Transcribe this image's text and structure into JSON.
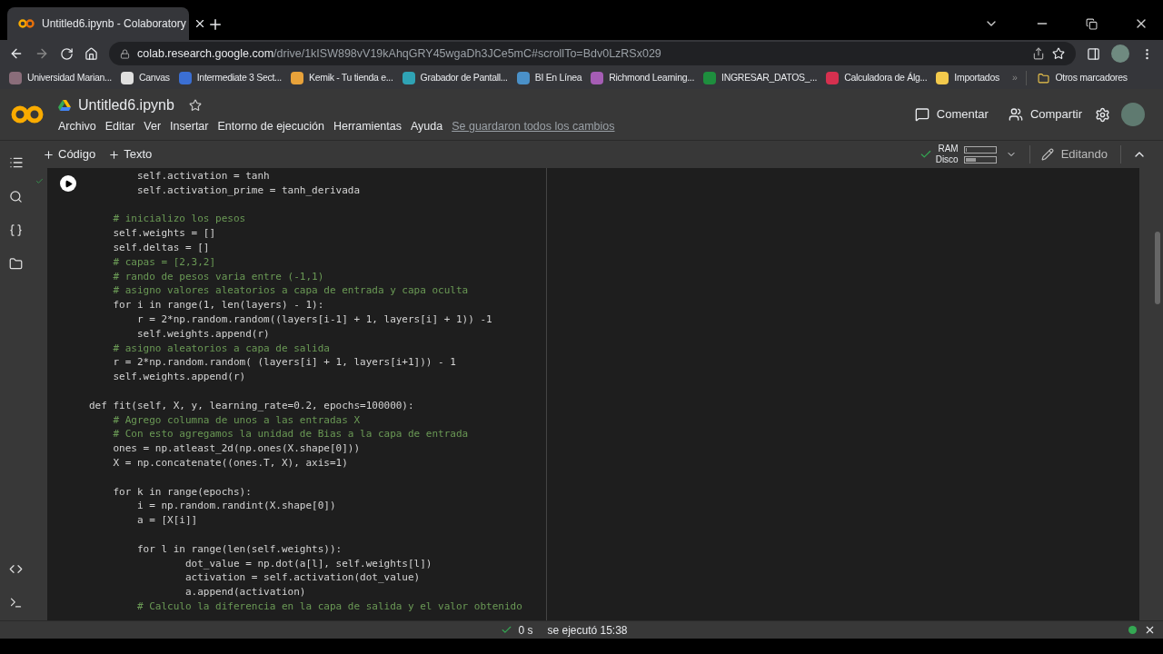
{
  "browser": {
    "tab_title": "Untitled6.ipynb - Colaboratory",
    "url_host": "colab.research.google.com",
    "url_path": "/drive/1kISW898vV19kAhqGRY45wgaDh3JCe5mC#scrollTo=Bdv0LzRSx029",
    "bookmarks": [
      {
        "label": "Universidad Marian...",
        "color": "#8a6d7a"
      },
      {
        "label": "Canvas",
        "color": "#e0e0e0"
      },
      {
        "label": "Intermediate 3 Sect...",
        "color": "#3b6fd4"
      },
      {
        "label": "Kemik - Tu tienda e...",
        "color": "#e8a23a"
      },
      {
        "label": "Grabador de Pantall...",
        "color": "#2fa3b5"
      },
      {
        "label": "BI En Línea",
        "color": "#4a90c8"
      },
      {
        "label": "Richmond Learning...",
        "color": "#a55db5"
      },
      {
        "label": "INGRESAR_DATOS_...",
        "color": "#1e8e3e"
      },
      {
        "label": "Calculadora de Álg...",
        "color": "#d6304f"
      },
      {
        "label": "Importados",
        "color": "#f2c94c"
      }
    ],
    "more_chevron": "»",
    "other_bookmarks": "Otros marcadores"
  },
  "notebook": {
    "title": "Untitled6.ipynb",
    "menu": [
      "Archivo",
      "Editar",
      "Ver",
      "Insertar",
      "Entorno de ejecución",
      "Herramientas",
      "Ayuda"
    ],
    "save_status": "Se guardaron todos los cambios",
    "comment": "Comentar",
    "share": "Compartir"
  },
  "toolbar": {
    "add_code": "Código",
    "add_text": "Texto",
    "ram_label": "RAM",
    "disk_label": "Disco",
    "ram": {
      "level": 0.05
    },
    "disk": {
      "level": 0.35
    },
    "edit_mode": "Editando"
  },
  "code_lines": [
    {
      "kind": "code",
      "text": "        self.activation = tanh"
    },
    {
      "kind": "code",
      "text": "        self.activation_prime = tanh_derivada"
    },
    {
      "kind": "blank"
    },
    {
      "kind": "comment",
      "text": "    # inicializo los pesos"
    },
    {
      "kind": "code",
      "text": "    self.weights = []"
    },
    {
      "kind": "code",
      "text": "    self.deltas = []"
    },
    {
      "kind": "comment",
      "text": "    # capas = [2,3,2]"
    },
    {
      "kind": "comment",
      "text": "    # rando de pesos varia entre (-1,1)"
    },
    {
      "kind": "comment",
      "text": "    # asigno valores aleatorios a capa de entrada y capa oculta"
    },
    {
      "kind": "code",
      "text": "    for i in range(1, len(layers) - 1):"
    },
    {
      "kind": "code",
      "text": "        r = 2*np.random.random((layers[i-1] + 1, layers[i] + 1)) -1"
    },
    {
      "kind": "code",
      "text": "        self.weights.append(r)"
    },
    {
      "kind": "comment",
      "text": "    # asigno aleatorios a capa de salida"
    },
    {
      "kind": "code",
      "text": "    r = 2*np.random.random( (layers[i] + 1, layers[i+1])) - 1"
    },
    {
      "kind": "code",
      "text": "    self.weights.append(r)"
    },
    {
      "kind": "blank"
    },
    {
      "kind": "code",
      "text": "def fit(self, X, y, learning_rate=0.2, epochs=100000):"
    },
    {
      "kind": "comment",
      "text": "    # Agrego columna de unos a las entradas X"
    },
    {
      "kind": "comment",
      "text": "    # Con esto agregamos la unidad de Bias a la capa de entrada"
    },
    {
      "kind": "code",
      "text": "    ones = np.atleast_2d(np.ones(X.shape[0]))"
    },
    {
      "kind": "code",
      "text": "    X = np.concatenate((ones.T, X), axis=1)"
    },
    {
      "kind": "blank"
    },
    {
      "kind": "code",
      "text": "    for k in range(epochs):"
    },
    {
      "kind": "code",
      "text": "        i = np.random.randint(X.shape[0])"
    },
    {
      "kind": "code",
      "text": "        a = [X[i]]"
    },
    {
      "kind": "blank"
    },
    {
      "kind": "code",
      "text": "        for l in range(len(self.weights)):"
    },
    {
      "kind": "code",
      "text": "                dot_value = np.dot(a[l], self.weights[l])"
    },
    {
      "kind": "code",
      "text": "                activation = self.activation(dot_value)"
    },
    {
      "kind": "code",
      "text": "                a.append(activation)"
    },
    {
      "kind": "comment",
      "text": "        # Calculo la diferencia en la capa de salida y el valor obtenido"
    }
  ],
  "status": {
    "duration": "0 s",
    "executed": "se ejecutó 15:38",
    "connected": true
  }
}
